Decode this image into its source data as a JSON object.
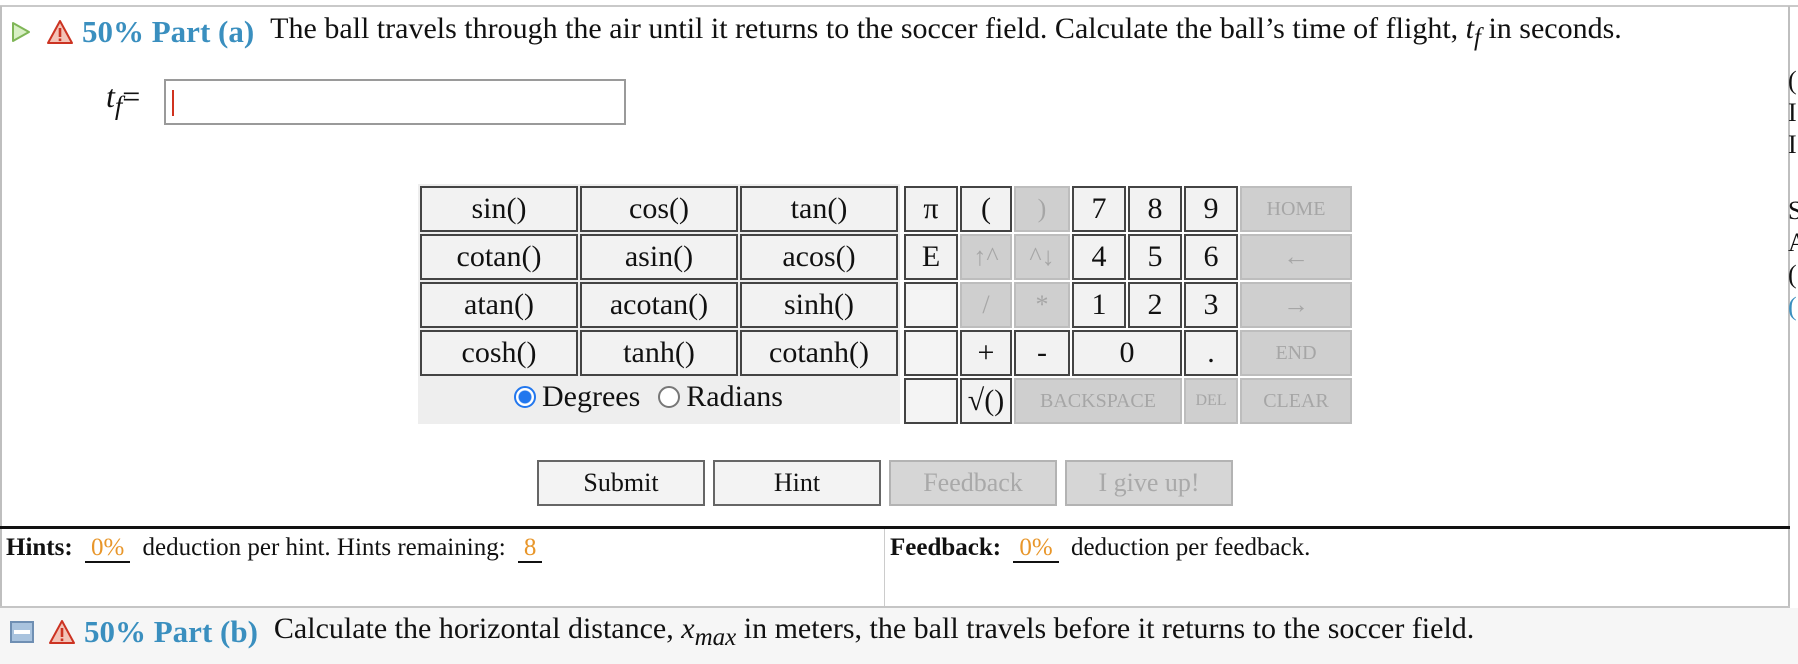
{
  "part_a": {
    "percent": "50% Part (a)",
    "question_text": "The ball travels through the air until it returns to the soccer field. Calculate the ball’s time of flight, ",
    "var_main": "t",
    "var_sub": "f",
    "question_tail": " in seconds."
  },
  "answer": {
    "label_main": "t",
    "label_sub": "f",
    "equals": "=",
    "value": ""
  },
  "keypad": {
    "functions": [
      "sin()",
      "cos()",
      "tan()",
      "cotan()",
      "asin()",
      "acos()",
      "atan()",
      "acotan()",
      "sinh()",
      "cosh()",
      "tanh()",
      "cotanh()"
    ],
    "pi": "π",
    "open_paren": "(",
    "close_paren": ")",
    "e": "E",
    "up_arrow": "↑^",
    "down_arrow": "^↓",
    "divide": "/",
    "multiply": "*",
    "plus": "+",
    "minus": "-",
    "sqrt": "√()",
    "digits": [
      "7",
      "8",
      "9",
      "4",
      "5",
      "6",
      "1",
      "2",
      "3",
      "0"
    ],
    "dot": ".",
    "home": "HOME",
    "left": "←",
    "right": "→",
    "end": "END",
    "backspace": "BACKSPACE",
    "del": "DEL",
    "clear": "CLEAR"
  },
  "angle_mode": {
    "degrees": "Degrees",
    "radians": "Radians",
    "selected": "Degrees"
  },
  "actions": {
    "submit": "Submit",
    "hint": "Hint",
    "feedback": "Feedback",
    "give_up": "I give up!"
  },
  "hints": {
    "label": "Hints:",
    "deduction": "0%",
    "text": "deduction per hint. Hints remaining:",
    "remaining": "8"
  },
  "feedback_info": {
    "label": "Feedback:",
    "deduction": "0%",
    "text": "deduction per feedback."
  },
  "part_b": {
    "percent": "50% Part (b)",
    "question_text": "Calculate the horizontal distance, ",
    "var_main": "x",
    "var_sub": "max",
    "question_tail": " in meters, the ball travels before it returns to the soccer field."
  },
  "edge_fragments": [
    "(",
    "I",
    "I",
    "S",
    "A",
    "(",
    "("
  ],
  "colors": {
    "accent_blue": "#3a8fbf",
    "highlight_orange": "#e8962a",
    "warning_red": "#cc3322",
    "caret_red": "#d0321f"
  }
}
